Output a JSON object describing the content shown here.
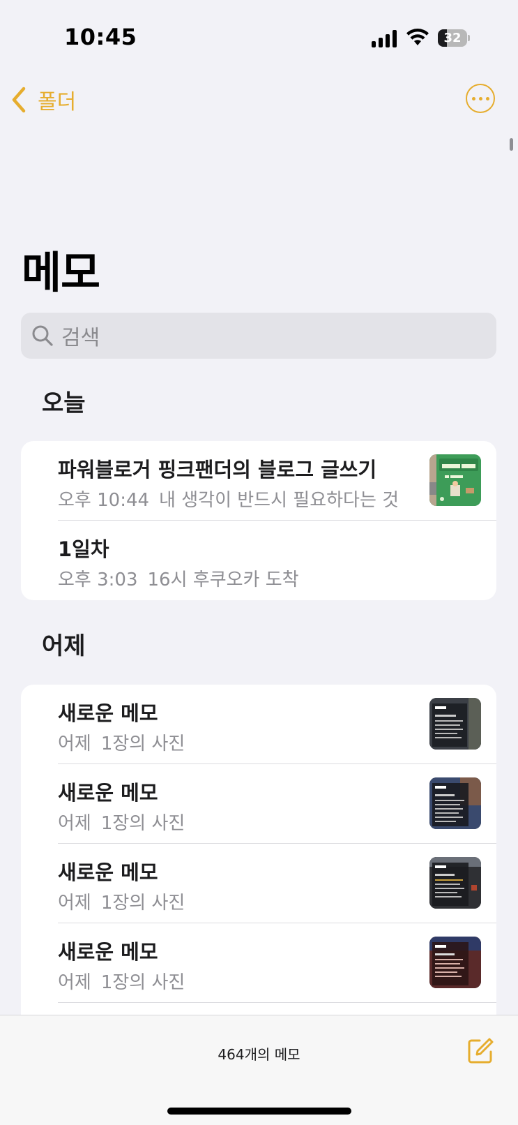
{
  "status": {
    "time": "10:45",
    "battery": "32",
    "battery_level": 0.32
  },
  "nav": {
    "back_label": "폴더",
    "back_icon": "chevron-left-icon",
    "more_icon": "ellipsis-circle-icon"
  },
  "page": {
    "title": "메모"
  },
  "search": {
    "placeholder": "검색"
  },
  "sections": [
    {
      "title": "오늘",
      "notes": [
        {
          "title": "파워블로거 핑크팬더의 블로그 글쓰기",
          "time": "오후 10:44",
          "preview": "내 생각이 반드시 필요하다는 것",
          "has_thumbnail": true
        },
        {
          "title": "1일차",
          "time": "오후 3:03",
          "preview": "16시 후쿠오카 도착",
          "has_thumbnail": false
        }
      ]
    },
    {
      "title": "어제",
      "notes": [
        {
          "title": "새로운 메모",
          "time": "어제",
          "preview": "1장의 사진",
          "has_thumbnail": true
        },
        {
          "title": "새로운 메모",
          "time": "어제",
          "preview": "1장의 사진",
          "has_thumbnail": true
        },
        {
          "title": "새로운 메모",
          "time": "어제",
          "preview": "1장의 사진",
          "has_thumbnail": true
        },
        {
          "title": "새로운 메모",
          "time": "어제",
          "preview": "1장의 사진",
          "has_thumbnail": true
        }
      ]
    }
  ],
  "footer": {
    "count_label": "464개의 메모",
    "compose_icon": "compose-icon"
  },
  "colors": {
    "accent": "#e6ad2e",
    "background": "#f2f2f7",
    "secondary_text": "#8e8e93"
  }
}
